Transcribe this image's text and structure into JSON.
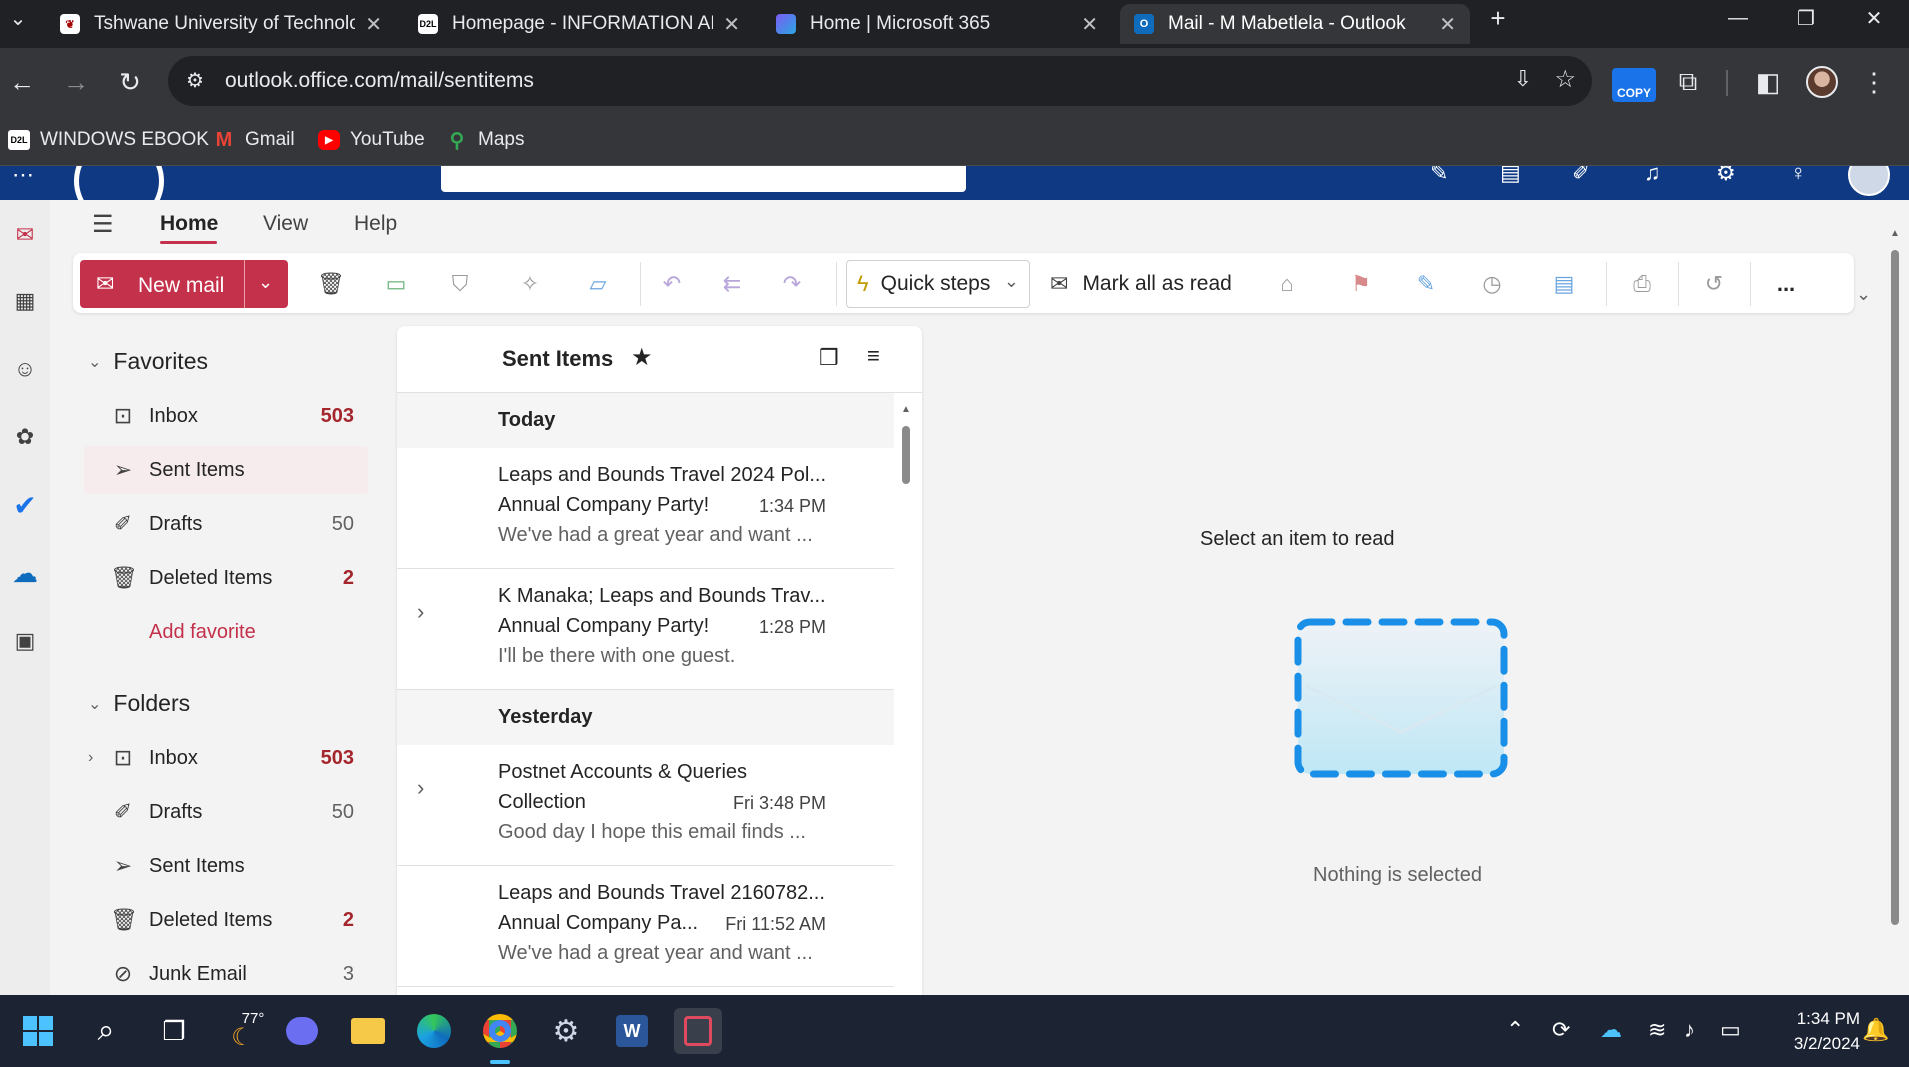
{
  "browser": {
    "tabs": [
      {
        "title": "Tshwane University of Technolo",
        "active": false
      },
      {
        "title": "Homepage - INFORMATION AD",
        "active": false
      },
      {
        "title": "Home | Microsoft 365",
        "active": false
      },
      {
        "title": "Mail - M Mabetlela - Outlook",
        "active": true
      }
    ],
    "url": "outlook.office.com/mail/sentitems",
    "copy_badge": "COPY",
    "bookmarks": [
      "WINDOWS EBOOK",
      "Gmail",
      "YouTube",
      "Maps"
    ],
    "bookmark_icon_text": "D2L"
  },
  "ribbon": {
    "tabs": [
      "Home",
      "View",
      "Help"
    ],
    "new_mail_label": "New mail",
    "quick_steps_label": "Quick steps",
    "mark_all_read_label": "Mark all as read",
    "more_label": "..."
  },
  "folders": {
    "favorites_title": "Favorites",
    "favorites": [
      {
        "name": "Inbox",
        "count": "503",
        "icon": "inbox-icon"
      },
      {
        "name": "Sent Items",
        "count": "",
        "icon": "send-icon"
      },
      {
        "name": "Drafts",
        "count": "50",
        "icon": "pencil-icon"
      },
      {
        "name": "Deleted Items",
        "count": "2",
        "icon": "trash-icon"
      }
    ],
    "add_favorite": "Add favorite",
    "folders_title": "Folders",
    "folders": [
      {
        "name": "Inbox",
        "count": "503",
        "icon": "inbox-icon"
      },
      {
        "name": "Drafts",
        "count": "50",
        "icon": "pencil-icon"
      },
      {
        "name": "Sent Items",
        "count": "",
        "icon": "send-icon"
      },
      {
        "name": "Deleted Items",
        "count": "2",
        "icon": "trash-icon"
      },
      {
        "name": "Junk Email",
        "count": "3",
        "icon": "junk-icon"
      }
    ]
  },
  "list": {
    "title": "Sent Items",
    "groups": [
      "Today",
      "Yesterday"
    ],
    "messages": [
      {
        "from": "Leaps and Bounds Travel 2024 Pol...",
        "subject": "Annual Company Party!",
        "time": "1:34 PM",
        "preview": "We've had a great year and want ..."
      },
      {
        "from": "K Manaka; Leaps and Bounds Trav...",
        "subject": "Annual Company Party!",
        "time": "1:28 PM",
        "preview": "I'll be there with one guest."
      },
      {
        "from": "Postnet Accounts & Queries",
        "subject": "Collection",
        "time": "Fri 3:48 PM",
        "preview": "Good day I hope this email finds ..."
      },
      {
        "from": "Leaps and Bounds Travel 2160782...",
        "subject": "Annual Company Pa...",
        "time": "Fri 11:52 AM",
        "preview": "We've had a great year and want ..."
      }
    ]
  },
  "reading": {
    "heading": "Select an item to read",
    "subtext": "Nothing is selected"
  },
  "taskbar": {
    "weather": "77°",
    "time": "1:34 PM",
    "date": "3/2/2024"
  },
  "colors": {
    "accent": "#c4314b",
    "header": "#0f3a83",
    "unread_count": "#a4262c"
  }
}
